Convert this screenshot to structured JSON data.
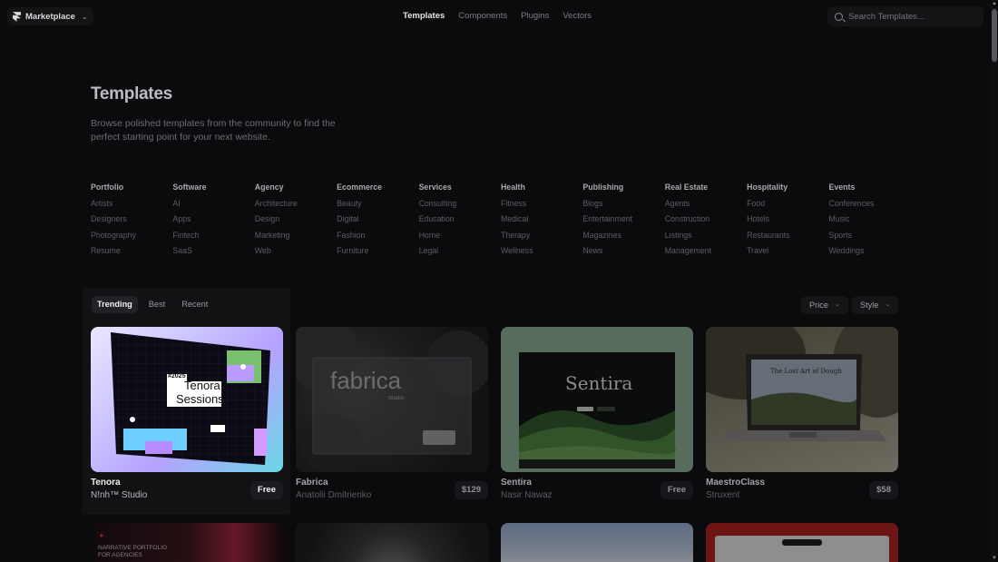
{
  "topbar": {
    "brand_label": "Marketplace",
    "nav": [
      "Templates",
      "Components",
      "Plugins",
      "Vectors"
    ],
    "active_nav": "Templates",
    "search_placeholder": "Search Templates..."
  },
  "hero": {
    "title": "Templates",
    "description": "Browse polished templates from the community to find the perfect starting point for your next website."
  },
  "categories": [
    {
      "title": "Portfolio",
      "items": [
        "Artists",
        "Designers",
        "Photography",
        "Resume"
      ]
    },
    {
      "title": "Software",
      "items": [
        "AI",
        "Apps",
        "Fintech",
        "SaaS"
      ]
    },
    {
      "title": "Agency",
      "items": [
        "Architecture",
        "Design",
        "Marketing",
        "Web"
      ]
    },
    {
      "title": "Ecommerce",
      "items": [
        "Beauty",
        "Digital",
        "Fashion",
        "Furniture"
      ]
    },
    {
      "title": "Services",
      "items": [
        "Consulting",
        "Education",
        "Home",
        "Legal"
      ]
    },
    {
      "title": "Health",
      "items": [
        "Fitness",
        "Medical",
        "Therapy",
        "Wellness"
      ]
    },
    {
      "title": "Publishing",
      "items": [
        "Blogs",
        "Entertainment",
        "Magazines",
        "News"
      ]
    },
    {
      "title": "Real Estate",
      "items": [
        "Agents",
        "Construction",
        "Listings",
        "Management"
      ]
    },
    {
      "title": "Hospitality",
      "items": [
        "Food",
        "Hotels",
        "Restaurants",
        "Travel"
      ]
    },
    {
      "title": "Events",
      "items": [
        "Conferences",
        "Music",
        "Sports",
        "Weddings"
      ]
    }
  ],
  "filters": {
    "tabs": [
      "Trending",
      "Best",
      "Recent"
    ],
    "active_tab": "Trending",
    "price_label": "Price",
    "style_label": "Style"
  },
  "templates": [
    {
      "name": "Tenora",
      "author": "N!nh™ Studio",
      "price": "Free",
      "preview": {
        "tag": "#2025",
        "line1": "Tenora",
        "line2": "Sessions."
      }
    },
    {
      "name": "Fabrica",
      "author": "Anatolii Dmitrienko",
      "price": "$129",
      "preview": {
        "word": "fabrica",
        "sub": "Studio"
      }
    },
    {
      "name": "Sentira",
      "author": "Nasir Nawaz",
      "price": "Free",
      "preview": {
        "word": "Sentira"
      }
    },
    {
      "name": "MaestroClass",
      "author": "Struxent",
      "price": "$58",
      "preview": {
        "headline": "The Lost Art of Dough"
      }
    }
  ],
  "next_row_preview": {
    "text": "NARRATIVE PORTFOLIO FOR AGENCIES"
  },
  "colors": {
    "background": "#0b0a0c",
    "panel": "#121114",
    "accent_trending": "#222125"
  }
}
